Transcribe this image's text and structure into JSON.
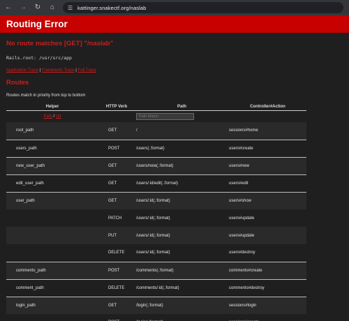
{
  "browser": {
    "url": "kattinger.snakectf.org/naslab"
  },
  "header": {
    "title": "Routing Error"
  },
  "error": {
    "message": "No route matches [GET] \"/naslab\"",
    "rails_root": "Rails.root: /usr/src/app"
  },
  "trace_links": {
    "application": "Application Trace",
    "framework": "Framework Trace",
    "full": "Full Trace",
    "sep": " | "
  },
  "routes": {
    "title": "Routes",
    "description": "Routes match in priority from top to bottom",
    "columns": [
      "Helper",
      "HTTP Verb",
      "Path",
      "Controller#Action"
    ],
    "filter": {
      "path_link": "Path",
      "sep": " / ",
      "url_link": "Url",
      "placeholder": "Path Match"
    },
    "rows": [
      {
        "helper": "root_path",
        "verb": "GET",
        "path": "/",
        "action": "sessions#home"
      },
      {
        "helper": "users_path",
        "verb": "POST",
        "path": "/users(.:format)",
        "action": "users#create"
      },
      {
        "helper": "new_user_path",
        "verb": "GET",
        "path": "/users/new(.:format)",
        "action": "users#new"
      },
      {
        "helper": "edit_user_path",
        "verb": "GET",
        "path": "/users/:id/edit(.:format)",
        "action": "users#edit"
      },
      {
        "helper": "user_path",
        "verb": "GET",
        "path": "/users/:id(.:format)",
        "action": "users#show"
      },
      {
        "helper": "",
        "verb": "PATCH",
        "path": "/users/:id(.:format)",
        "action": "users#update"
      },
      {
        "helper": "",
        "verb": "PUT",
        "path": "/users/:id(.:format)",
        "action": "users#update"
      },
      {
        "helper": "",
        "verb": "DELETE",
        "path": "/users/:id(.:format)",
        "action": "users#destroy"
      },
      {
        "helper": "comments_path",
        "verb": "POST",
        "path": "/comments(.:format)",
        "action": "comments#create"
      },
      {
        "helper": "comment_path",
        "verb": "DELETE",
        "path": "/comments/:id(.:format)",
        "action": "comments#destroy"
      },
      {
        "helper": "login_path",
        "verb": "GET",
        "path": "/login(.:format)",
        "action": "sessions#login"
      },
      {
        "helper": "",
        "verb": "POST",
        "path": "/login(.:format)",
        "action": "sessions#create"
      }
    ]
  }
}
